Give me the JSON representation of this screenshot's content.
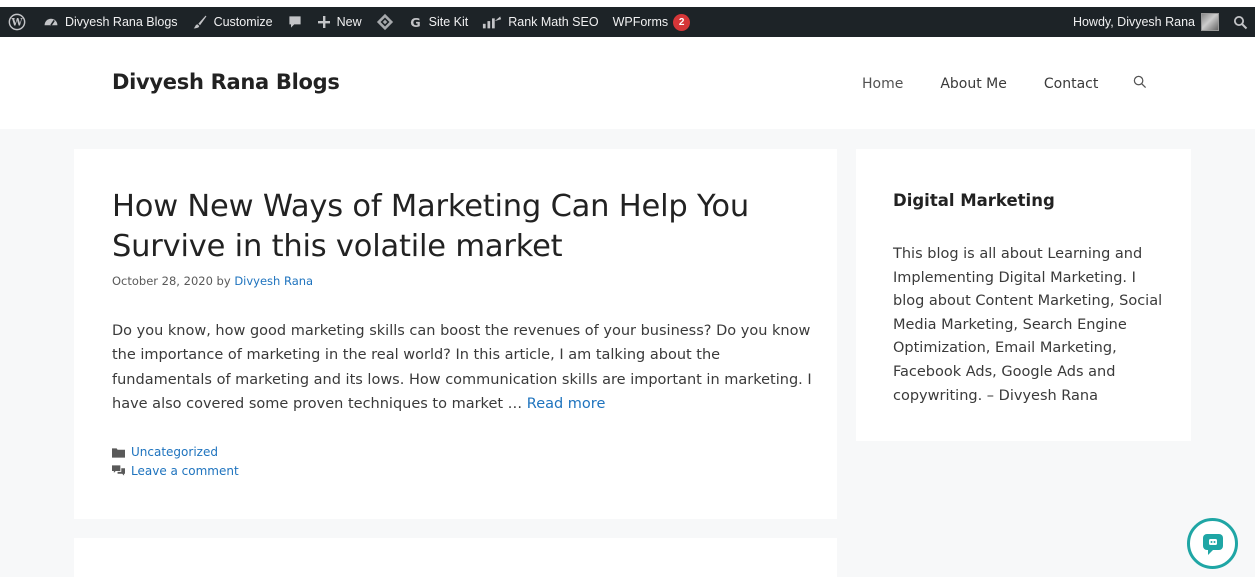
{
  "adminbar": {
    "site_name": "Divyesh Rana Blogs",
    "customize": "Customize",
    "new": "New",
    "site_kit": "Site Kit",
    "rank_math": "Rank Math SEO",
    "wpforms": "WPForms",
    "wpforms_count": "2",
    "howdy": "Howdy, Divyesh Rana"
  },
  "header": {
    "site_title": "Divyesh Rana Blogs",
    "nav": [
      "Home",
      "About Me",
      "Contact"
    ]
  },
  "post": {
    "title": "How New Ways of Marketing Can Help You Survive in this volatile market",
    "date_by": "October 28, 2020 by ",
    "author": "Divyesh Rana",
    "excerpt": "Do you know, how good marketing skills can boost the revenues of your business? Do you know the importance of marketing in the real world? In this article, I am talking about the fundamentals of marketing and its lows. How communication skills are important in marketing. I have also covered some proven techniques to market … ",
    "read_more": "Read more",
    "category": "Uncategorized",
    "comment": "Leave a comment"
  },
  "widget": {
    "title": "Digital Marketing",
    "text": "This blog is all about Learning and Implementing Digital Marketing. I blog about Content Marketing, Social Media Marketing, Search Engine Optimization, Email Marketing, Facebook Ads, Google Ads and copywriting. – Divyesh Rana"
  },
  "colors": {
    "adminbar_bg": "#1d2327",
    "link": "#1e73be",
    "badge": "#d63638",
    "chat_accent": "#1fa6a5"
  }
}
